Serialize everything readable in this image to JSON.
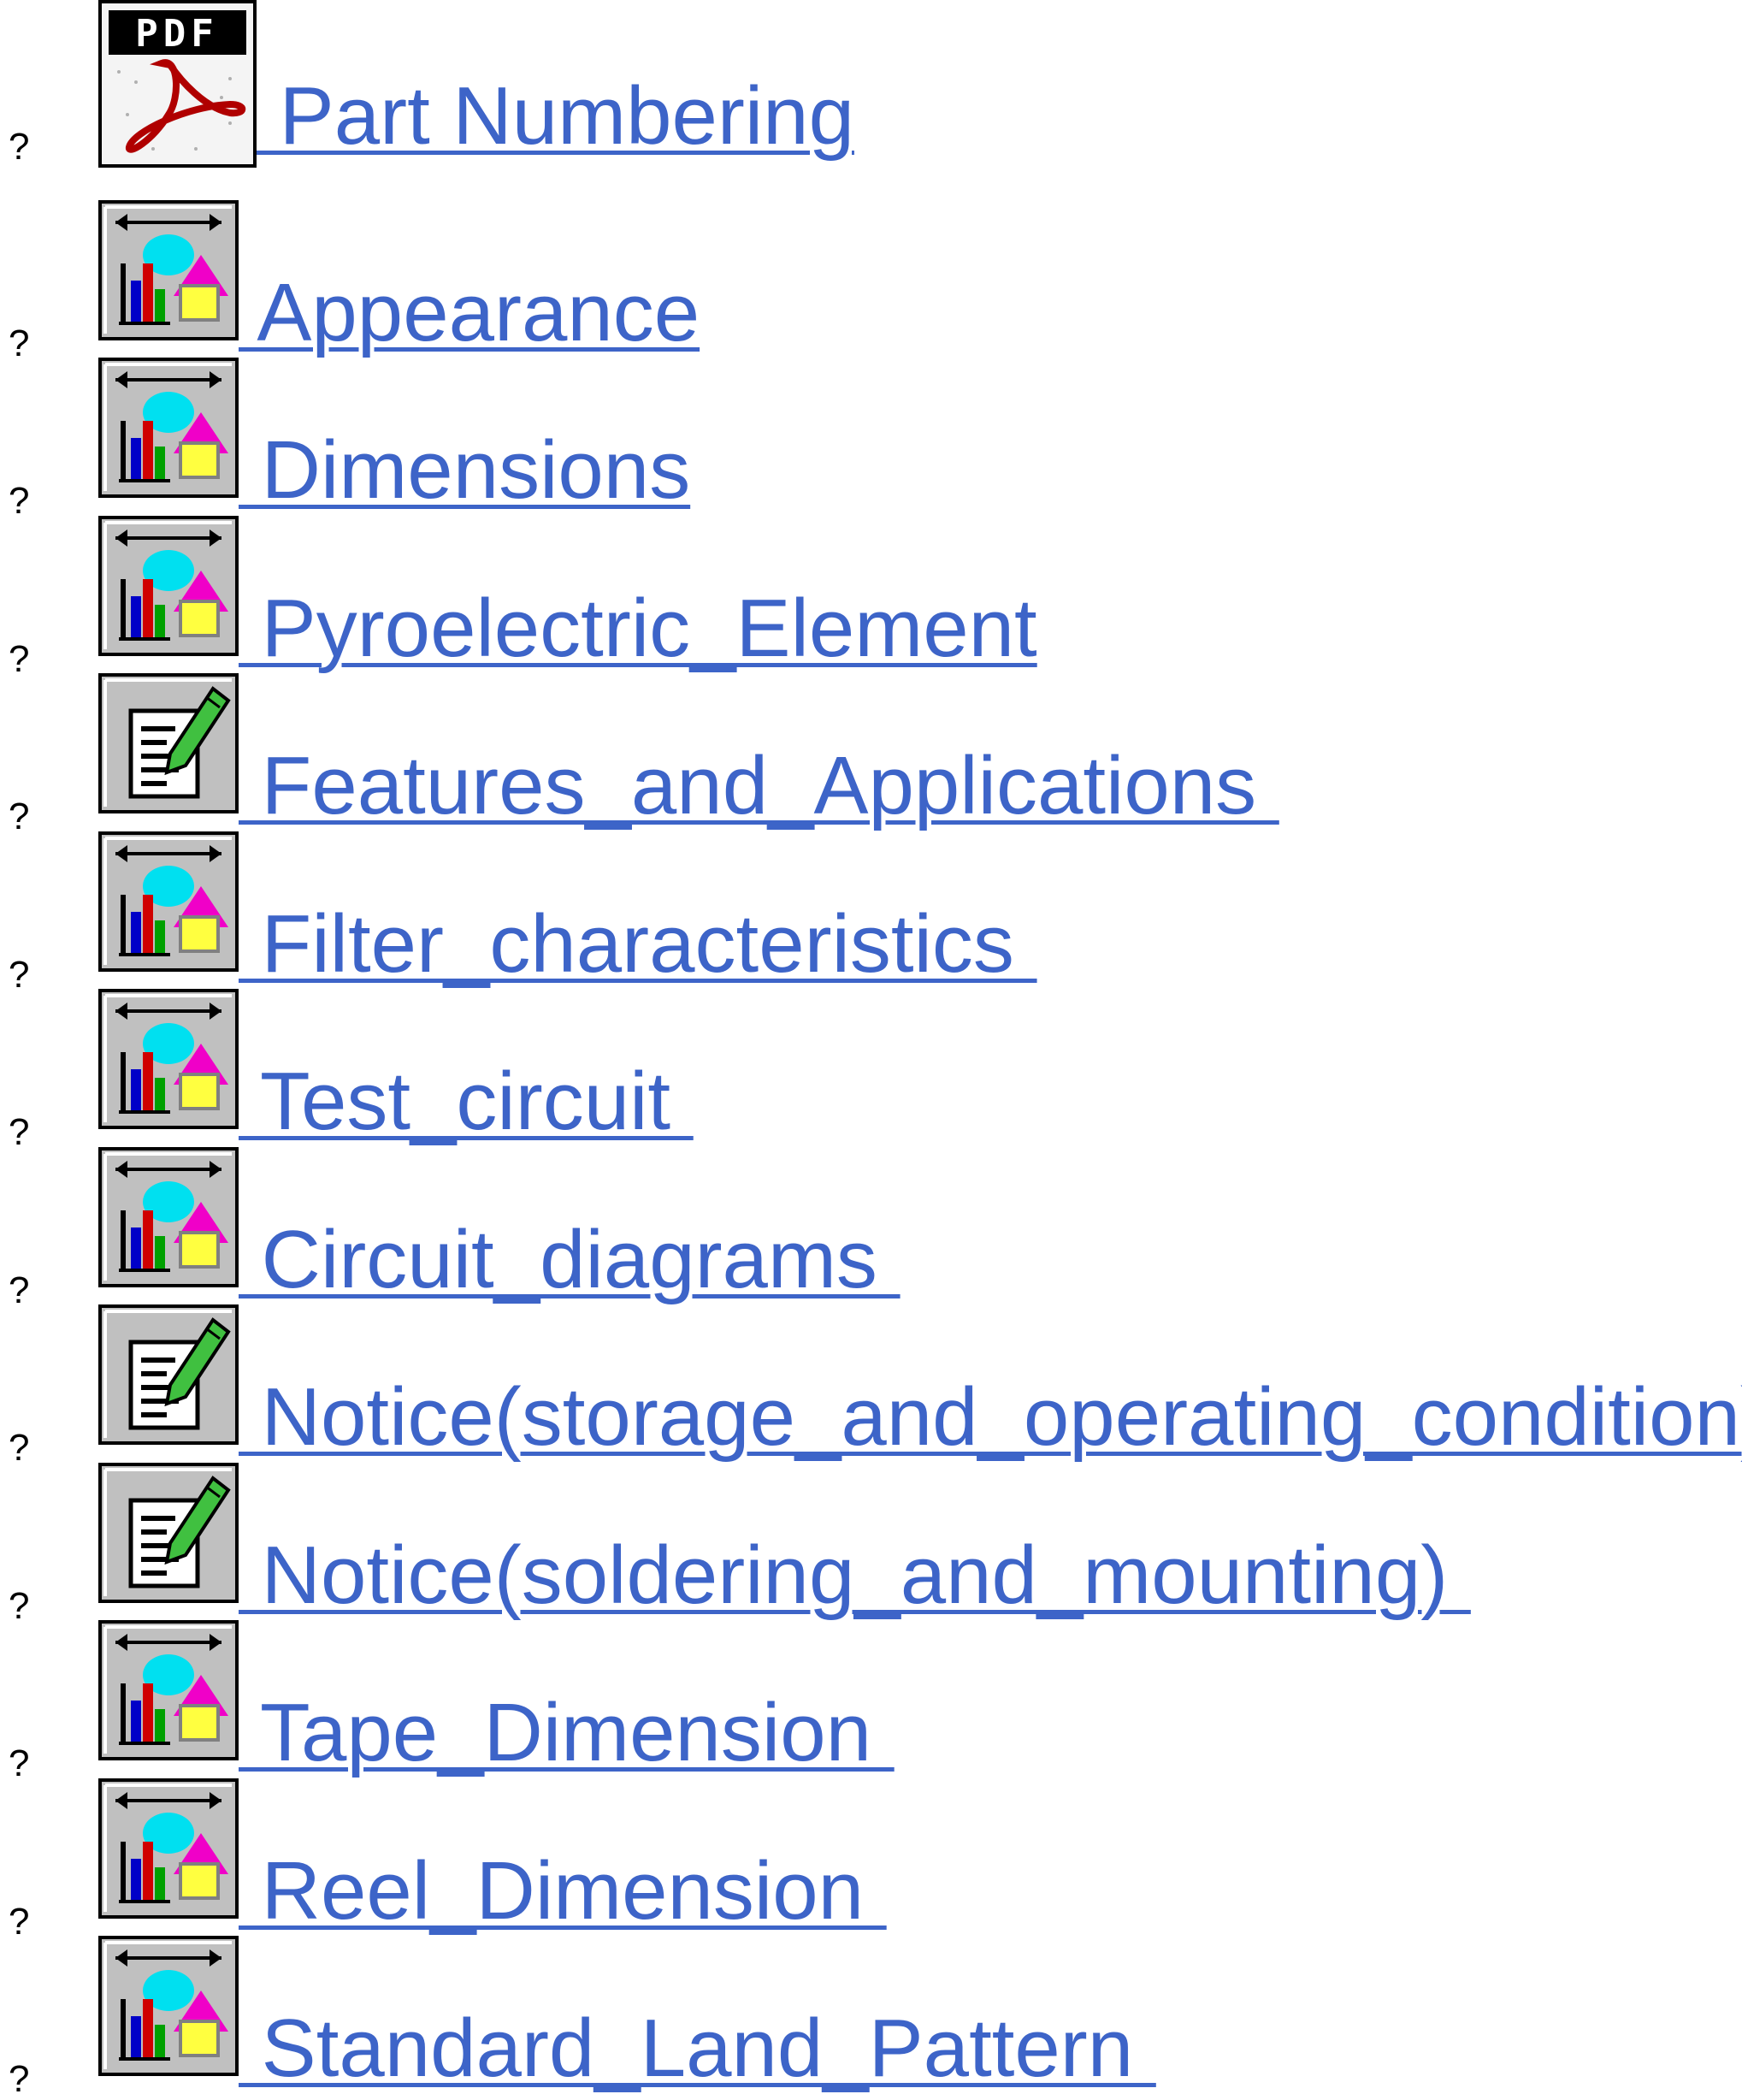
{
  "items": [
    {
      "bullet": "?",
      "label": " Part Numbering",
      "icon": "pdf-icon"
    },
    {
      "bullet": "?",
      "label": " Appearance",
      "icon": "chart-dimension-icon"
    },
    {
      "bullet": "?",
      "label": " Dimensions",
      "icon": "chart-dimension-icon"
    },
    {
      "bullet": "?",
      "label": " Pyroelectric_Element",
      "icon": "chart-dimension-icon"
    },
    {
      "bullet": "?",
      "label": " Features_and_Applications ",
      "icon": "document-edit-icon"
    },
    {
      "bullet": "?",
      "label": " Filter_characteristics ",
      "icon": "chart-dimension-icon"
    },
    {
      "bullet": "?",
      "label": " Test_circuit ",
      "icon": "chart-dimension-icon"
    },
    {
      "bullet": "?",
      "label": " Circuit_diagrams ",
      "icon": "chart-dimension-icon"
    },
    {
      "bullet": "?",
      "label": " Notice(storage_and_operating_condition) ",
      "icon": "document-edit-icon"
    },
    {
      "bullet": "?",
      "label": " Notice(soldering_and_mounting) ",
      "icon": "document-edit-icon"
    },
    {
      "bullet": "?",
      "label": " Tape_Dimension ",
      "icon": "chart-dimension-icon"
    },
    {
      "bullet": "?",
      "label": " Reel_Dimension ",
      "icon": "chart-dimension-icon"
    },
    {
      "bullet": "?",
      "label": " Standard_Land_Pattern ",
      "icon": "chart-dimension-icon"
    }
  ],
  "icon_labels": {
    "pdf": "PDF"
  },
  "colors": {
    "link": "#3d64c8",
    "bullet": "#000000",
    "background": "#ffffff"
  }
}
